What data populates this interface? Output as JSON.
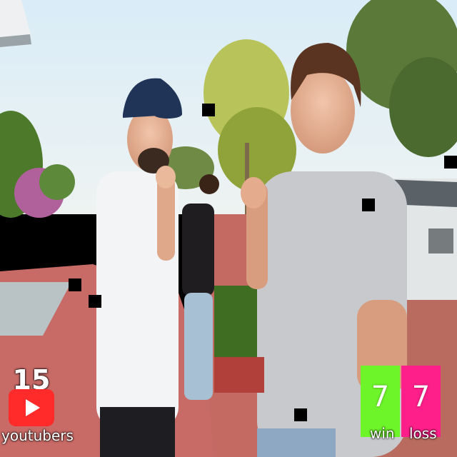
{
  "overlay": {
    "youtubers_count": "15",
    "youtubers_label": "youtubers",
    "win_count": "7",
    "win_label": "win",
    "loss_count": "7",
    "loss_label": "loss"
  },
  "colors": {
    "youtube_red": "#ff2b2b",
    "win_green": "#6ef52a",
    "loss_pink": "#ff1f8a"
  }
}
